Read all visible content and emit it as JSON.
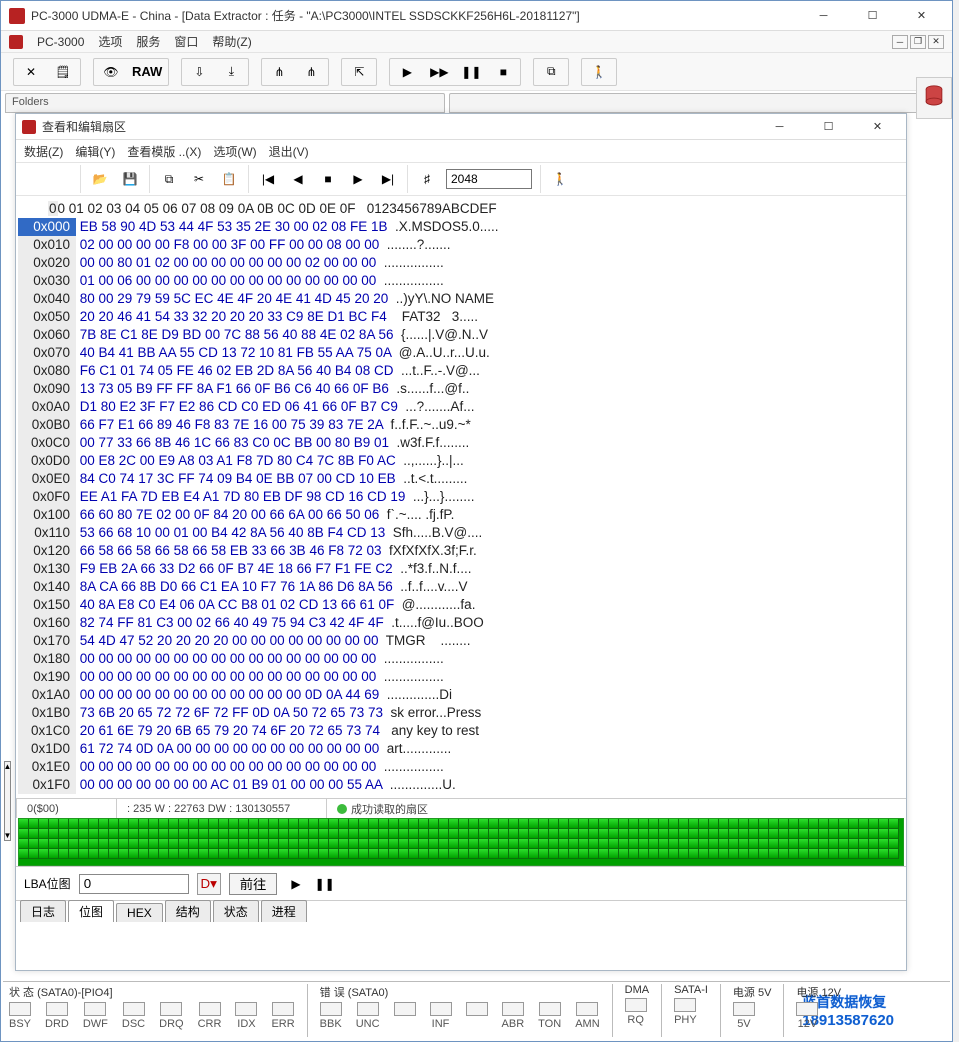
{
  "main_title": "PC-3000 UDMA-E - China - [Data Extractor : 任务 - \"A:\\PC3000\\INTEL SSDSCKKF256H6L-20181127\"]",
  "outer_menu": {
    "m0": "PC-3000",
    "m1": "选项",
    "m2": "服务",
    "m3": "窗口",
    "m4": "帮助(Z)"
  },
  "folders_label": "Folders",
  "raw_label": "RAW",
  "inner_window": {
    "title": "查看和编辑扇区",
    "menu": {
      "m0": "数据(Z)",
      "m1": "编辑(Y)",
      "m2": "查看模版 ..(X)",
      "m3": "选项(W)",
      "m4": "退出(V)"
    },
    "sector_value": "2048",
    "hex_cols": "00 01 02 03 04 05 06 07 08 09 0A 0B 0C 0D 0E 0F   0123456789ABCDEF",
    "rows": [
      {
        "addr": "0x000",
        "hex": "EB 58 90 4D 53 44 4F 53 35 2E 30 00 02 08 FE 1B",
        "ascii": ".X.MSDOS5.0....."
      },
      {
        "addr": "0x010",
        "hex": "02 00 00 00 00 F8 00 00 3F 00 FF 00 00 08 00 00",
        "ascii": "........?......."
      },
      {
        "addr": "0x020",
        "hex": "00 00 80 01 02 00 00 00 00 00 00 00 02 00 00 00",
        "ascii": "................"
      },
      {
        "addr": "0x030",
        "hex": "01 00 06 00 00 00 00 00 00 00 00 00 00 00 00 00",
        "ascii": "................"
      },
      {
        "addr": "0x040",
        "hex": "80 00 29 79 59 5C EC 4E 4F 20 4E 41 4D 45 20 20",
        "ascii": "..)yY\\.NO NAME  "
      },
      {
        "addr": "0x050",
        "hex": "20 20 46 41 54 33 32 20 20 20 33 C9 8E D1 BC F4",
        "ascii": "  FAT32   3....."
      },
      {
        "addr": "0x060",
        "hex": "7B 8E C1 8E D9 BD 00 7C 88 56 40 88 4E 02 8A 56",
        "ascii": "{......|.V@.N..V"
      },
      {
        "addr": "0x070",
        "hex": "40 B4 41 BB AA 55 CD 13 72 10 81 FB 55 AA 75 0A",
        "ascii": "@.A..U..r...U.u."
      },
      {
        "addr": "0x080",
        "hex": "F6 C1 01 74 05 FE 46 02 EB 2D 8A 56 40 B4 08 CD",
        "ascii": "...t..F..-.V@..."
      },
      {
        "addr": "0x090",
        "hex": "13 73 05 B9 FF FF 8A F1 66 0F B6 C6 40 66 0F B6",
        "ascii": ".s......f...@f.."
      },
      {
        "addr": "0x0A0",
        "hex": "D1 80 E2 3F F7 E2 86 CD C0 ED 06 41 66 0F B7 C9",
        "ascii": "...?.......Af..."
      },
      {
        "addr": "0x0B0",
        "hex": "66 F7 E1 66 89 46 F8 83 7E 16 00 75 39 83 7E 2A",
        "ascii": "f..f.F..~..u9.~*"
      },
      {
        "addr": "0x0C0",
        "hex": "00 77 33 66 8B 46 1C 66 83 C0 0C BB 00 80 B9 01",
        "ascii": ".w3f.F.f........"
      },
      {
        "addr": "0x0D0",
        "hex": "00 E8 2C 00 E9 A8 03 A1 F8 7D 80 C4 7C 8B F0 AC",
        "ascii": "..,......}..|..."
      },
      {
        "addr": "0x0E0",
        "hex": "84 C0 74 17 3C FF 74 09 B4 0E BB 07 00 CD 10 EB",
        "ascii": "..t.<.t........."
      },
      {
        "addr": "0x0F0",
        "hex": "EE A1 FA 7D EB E4 A1 7D 80 EB DF 98 CD 16 CD 19",
        "ascii": "...}...}........"
      },
      {
        "addr": "0x100",
        "hex": "66 60 80 7E 02 00 0F 84 20 00 66 6A 00 66 50 06",
        "ascii": "f`.~.... .fj.fP."
      },
      {
        "addr": "0x110",
        "hex": "53 66 68 10 00 01 00 B4 42 8A 56 40 8B F4 CD 13",
        "ascii": "Sfh.....B.V@...."
      },
      {
        "addr": "0x120",
        "hex": "66 58 66 58 66 58 66 58 EB 33 66 3B 46 F8 72 03",
        "ascii": "fXfXfXfX.3f;F.r."
      },
      {
        "addr": "0x130",
        "hex": "F9 EB 2A 66 33 D2 66 0F B7 4E 18 66 F7 F1 FE C2",
        "ascii": "..*f3.f..N.f...."
      },
      {
        "addr": "0x140",
        "hex": "8A CA 66 8B D0 66 C1 EA 10 F7 76 1A 86 D6 8A 56",
        "ascii": "..f..f....v....V"
      },
      {
        "addr": "0x150",
        "hex": "40 8A E8 C0 E4 06 0A CC B8 01 02 CD 13 66 61 0F",
        "ascii": "@............fa."
      },
      {
        "addr": "0x160",
        "hex": "82 74 FF 81 C3 00 02 66 40 49 75 94 C3 42 4F 4F",
        "ascii": ".t.....f@Iu..BOO"
      },
      {
        "addr": "0x170",
        "hex": "54 4D 47 52 20 20 20 20 00 00 00 00 00 00 00 00",
        "ascii": "TMGR    ........"
      },
      {
        "addr": "0x180",
        "hex": "00 00 00 00 00 00 00 00 00 00 00 00 00 00 00 00",
        "ascii": "................"
      },
      {
        "addr": "0x190",
        "hex": "00 00 00 00 00 00 00 00 00 00 00 00 00 00 00 00",
        "ascii": "................"
      },
      {
        "addr": "0x1A0",
        "hex": "00 00 00 00 00 00 00 00 00 00 00 00 0D 0A 44 69",
        "ascii": "..............Di"
      },
      {
        "addr": "0x1B0",
        "hex": "73 6B 20 65 72 72 6F 72 FF 0D 0A 50 72 65 73 73",
        "ascii": "sk error...Press"
      },
      {
        "addr": "0x1C0",
        "hex": "20 61 6E 79 20 6B 65 79 20 74 6F 20 72 65 73 74",
        "ascii": " any key to rest"
      },
      {
        "addr": "0x1D0",
        "hex": "61 72 74 0D 0A 00 00 00 00 00 00 00 00 00 00 00",
        "ascii": "art............."
      },
      {
        "addr": "0x1E0",
        "hex": "00 00 00 00 00 00 00 00 00 00 00 00 00 00 00 00",
        "ascii": "................"
      },
      {
        "addr": "0x1F0",
        "hex": "00 00 00 00 00 00 00 AC 01 B9 01 00 00 00 55 AA",
        "ascii": "..............U."
      }
    ]
  },
  "statusbar": {
    "pos": "0($00)",
    "size": ": 235 W : 22763 DW : 130130557",
    "msg": "成功读取的扇区"
  },
  "lba": {
    "label": "LBA位图",
    "value": "0",
    "goto": "前往"
  },
  "overlay": {
    "line1": "蓝首数据恢复",
    "line2": "18913587620"
  },
  "tabs": {
    "t0": "日志",
    "t1": "位图",
    "t2": "HEX",
    "t3": "结构",
    "t4": "状态",
    "t5": "进程"
  },
  "bottom": {
    "sata0": "状 态 (SATA0)-[PIO4]",
    "sata0_leds": [
      "BSY",
      "DRD",
      "DWF",
      "DSC",
      "DRQ",
      "CRR",
      "IDX",
      "ERR"
    ],
    "err": "错 误 (SATA0)",
    "err_leds": [
      "BBK",
      "UNC",
      "",
      "INF",
      "",
      "ABR",
      "TON",
      "AMN"
    ],
    "dma": "DMA",
    "dma_led": "RQ",
    "satai": "SATA-I",
    "satai_led": "PHY",
    "p5": "电源 5V",
    "p5_led": "5V",
    "p12": "电源 12V",
    "p12_led": "12V"
  }
}
